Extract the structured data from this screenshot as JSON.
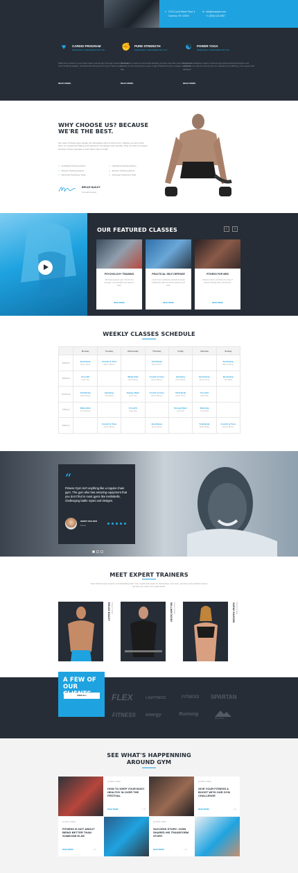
{
  "colors": {
    "accent": "#1fa3e0",
    "dark": "#262d36",
    "light": "#f3f3f3"
  },
  "top": {
    "address_line1": "2715 Court Street Floor 4",
    "address_line2": "Cumnoc, NY 10019",
    "email": "info@example.com",
    "phone": "+1 (800) 123-4567"
  },
  "programs": [
    {
      "icon": "heart-pulse-icon",
      "title": "CARDIO PROGRAM",
      "subtitle": "PERSONALLY DESIGNED FOR YOU",
      "text": "Made the muscles of your body larger and stronger through various exercises such as lifting weights, professional training and our gym trainer team.",
      "more": "READ MORE"
    },
    {
      "icon": "muscle-icon",
      "title": "PURE STRENGTH",
      "subtitle": "PERSONALLY DESIGNED FOR YOU",
      "text": "Running is a method of terrestrial allowing humans and other animals to move rapidly on foot. Running is a type of gait characterized by a stage in which all feet.",
      "more": "READ MORE"
    },
    {
      "icon": "yoga-icon",
      "title": "POWER YOGA",
      "subtitle": "PERSONALLY DESIGNED FOR YOU",
      "text": "Yoga is a meditative means of discovering dysfunctional perception and cognition, as well as overcoming it for release from suffering, inner peace and salvation.",
      "more": "READ MORE"
    }
  ],
  "why": {
    "title_line1": "WHY CHOOSE US? BECAUSE",
    "title_line2": "WE'RE THE BEST.",
    "text": "Our team of fitness gym people you will always want to work out in, whether you are a first-timer or a seasoned athlete and training for something more specific. Why not visit our newest Kid Gym Center and take a tour? We're here to help!",
    "list_left": [
      "Individual training options",
      "Fitness Training options",
      "Personal Training to Help"
    ],
    "list_right": [
      "Unlimited training classes",
      "Fitness Training options",
      "Personal Training to Help"
    ],
    "signature": "Bruce Bailey",
    "name": "BRUCE BAILEY",
    "role": "CrossFit Expert"
  },
  "featured": {
    "title": "OUR FEATURED CLASSES",
    "prev": "‹",
    "next": "›",
    "classes": [
      {
        "title": "PSYCHOLOGY TRAINING",
        "text": "Winning requires your mind to be stronger, more flexible and quick to react.",
        "more": "READ MORE"
      },
      {
        "title": "PRACTICAL SELF DEFENSE",
        "text": "Learn how to defend yourself and gain confidence with our expert staff by your side.",
        "more": "READ MORE"
      },
      {
        "title": "FITNESS FOR MEN",
        "text": "Fitness Center provides an array of fitness training with instruments.",
        "more": "READ MORE"
      }
    ]
  },
  "schedule": {
    "title": "WEEKLY CLASSES SCHEDULE",
    "days": [
      "",
      "Monday",
      "Tuesday",
      "Wednesday",
      "Thursday",
      "Friday",
      "Saturday",
      "Sunday"
    ],
    "rows": [
      {
        "time": "6:00 am",
        "cells": [
          [
            "BootCamp",
            "James Tanner"
          ],
          [
            "Crunch & Tone",
            "Marcus Barnes"
          ],
          [
            "",
            ""
          ],
          [
            "Total Body",
            "Danny Simon"
          ],
          [
            "",
            ""
          ],
          [
            "",
            ""
          ],
          [
            "BootCamp",
            "Marcus Barnes"
          ]
        ]
      },
      {
        "time": "8:00 am",
        "cells": [
          [
            "CrossFit",
            "Logan Tate"
          ],
          [
            "",
            ""
          ],
          [
            "Waterslide",
            "Kelly Dawson"
          ],
          [
            "Crunch & Tone",
            "Marcus Barnes"
          ],
          [
            "Spinning",
            "Kelly Dawson"
          ],
          [
            "BootCamp",
            "James Tanner"
          ],
          [
            "BootCamp",
            "Pam Blake"
          ]
        ]
      },
      {
        "time": "10:00 am",
        "cells": [
          [
            "Total Body",
            "Sarah Bradley"
          ],
          [
            "Spinning",
            "Tony Banks"
          ],
          [
            "Energy Blast",
            "Lisa Curtis"
          ],
          [
            "Crunch & Tone",
            "Marcus Barnes"
          ],
          [
            "Total Body",
            "Danny Simon"
          ],
          [
            "CrossFit",
            "Logan Tate"
          ],
          [
            "",
            ""
          ]
        ]
      },
      {
        "time": "4:00 pm",
        "cells": [
          [
            "Waterslide",
            "Kelly Dawson"
          ],
          [
            "",
            ""
          ],
          [
            "CrossFit",
            "Logan Tate"
          ],
          [
            "",
            ""
          ],
          [
            "Energy Blast",
            "Lisa Curtis"
          ],
          [
            "Spinning",
            "Tony Banks"
          ],
          [
            "",
            ""
          ]
        ]
      },
      {
        "time": "6:00 pm",
        "cells": [
          [
            "",
            ""
          ],
          [
            "Crunch & Tone",
            "Marcus Barnes"
          ],
          [
            "",
            ""
          ],
          [
            "BootCamp",
            "James Tanner"
          ],
          [
            "",
            ""
          ],
          [
            "Total Body",
            "Sarah Bradley"
          ],
          [
            "Crunch & Tone",
            "Marcus Barnes"
          ]
        ]
      }
    ]
  },
  "testimonial": {
    "quote_mark": "“",
    "text": "Fitness Gym isn't anything like a regular chain gym. The gym also has amazing equipment that you don't find in most gyms like Kettlebells, challenging battle ropes and sledges.",
    "name": "HENRY WALKER",
    "role": "Expert"
  },
  "trainers": {
    "title": "MEET EXPERT TRAINERS",
    "subtitle": "Train with the best experts in bodybuilding field. Your results will speak for themselves. Our team members and certified trainers will help you reach your goals faster.",
    "people": [
      {
        "name": "BRUCE BAILEY",
        "role": "Fitness Trainer"
      },
      {
        "name": "WILLIAM DIXON",
        "role": "Fitness Trainer"
      },
      {
        "name": "SARAH HASSON",
        "role": "Fitness Trainer"
      }
    ]
  },
  "clients": {
    "title": "A FEW OF OUR CLIENTS",
    "button": "VIEW ALL",
    "logos": [
      "FLEX",
      "LA|FITNESS",
      "FITNESS",
      "SPARTAN",
      "FITNESS",
      "energy",
      "Running",
      "Mountain"
    ]
  },
  "blog": {
    "title_line1": "SEE WHAT'S HAPPENNING",
    "title_line2": "AROUND GYM",
    "posts": [
      {
        "meta": "by Admin  |  Share",
        "title": "HOW TO KEEP YOUR BODY HEALTHY IN OVER THE FESTIVAL",
        "more": "READ MORE",
        "comments": "0"
      },
      {
        "meta": "by Admin  |  Share",
        "title": "GIVE YOUR FITNESS A BOOST WITH OUR GYM CHALLENGE",
        "more": "READ MORE",
        "comments": "0"
      },
      {
        "meta": "by Admin  |  Share",
        "title": "FITNESS IS NOT ABOUT BEING BETTER THAN SOMEONE ELSE",
        "more": "READ MORE",
        "comments": "0"
      },
      {
        "meta": "by Admin  |  Share",
        "title": "SUCCESS STORY: JOHN SHARES HIS TRANSFORM STORY",
        "more": "READ MORE",
        "comments": "0"
      }
    ]
  }
}
